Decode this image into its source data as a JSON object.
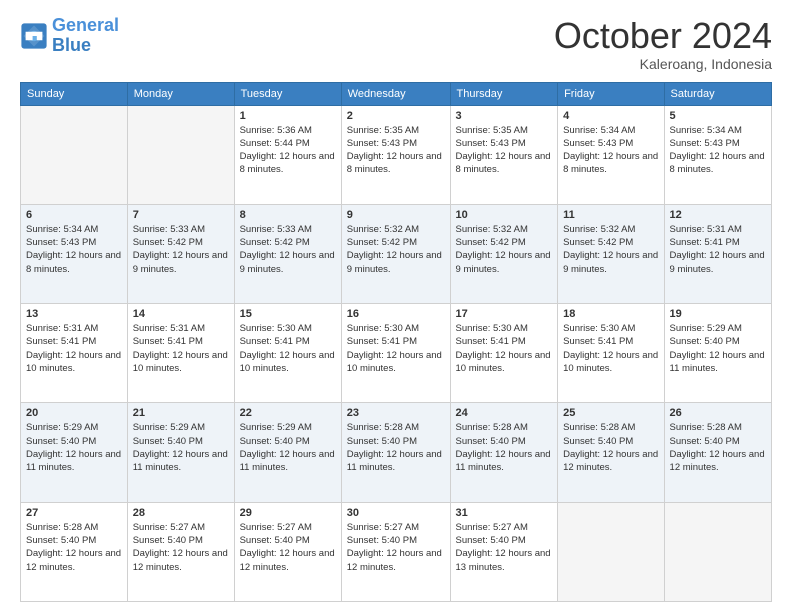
{
  "header": {
    "logo_general": "General",
    "logo_blue": "Blue",
    "month_title": "October 2024",
    "location": "Kaleroang, Indonesia"
  },
  "days_of_week": [
    "Sunday",
    "Monday",
    "Tuesday",
    "Wednesday",
    "Thursday",
    "Friday",
    "Saturday"
  ],
  "weeks": [
    [
      {
        "day": "",
        "info": ""
      },
      {
        "day": "",
        "info": ""
      },
      {
        "day": "1",
        "info": "Sunrise: 5:36 AM\nSunset: 5:44 PM\nDaylight: 12 hours and 8 minutes."
      },
      {
        "day": "2",
        "info": "Sunrise: 5:35 AM\nSunset: 5:43 PM\nDaylight: 12 hours and 8 minutes."
      },
      {
        "day": "3",
        "info": "Sunrise: 5:35 AM\nSunset: 5:43 PM\nDaylight: 12 hours and 8 minutes."
      },
      {
        "day": "4",
        "info": "Sunrise: 5:34 AM\nSunset: 5:43 PM\nDaylight: 12 hours and 8 minutes."
      },
      {
        "day": "5",
        "info": "Sunrise: 5:34 AM\nSunset: 5:43 PM\nDaylight: 12 hours and 8 minutes."
      }
    ],
    [
      {
        "day": "6",
        "info": "Sunrise: 5:34 AM\nSunset: 5:43 PM\nDaylight: 12 hours and 8 minutes."
      },
      {
        "day": "7",
        "info": "Sunrise: 5:33 AM\nSunset: 5:42 PM\nDaylight: 12 hours and 9 minutes."
      },
      {
        "day": "8",
        "info": "Sunrise: 5:33 AM\nSunset: 5:42 PM\nDaylight: 12 hours and 9 minutes."
      },
      {
        "day": "9",
        "info": "Sunrise: 5:32 AM\nSunset: 5:42 PM\nDaylight: 12 hours and 9 minutes."
      },
      {
        "day": "10",
        "info": "Sunrise: 5:32 AM\nSunset: 5:42 PM\nDaylight: 12 hours and 9 minutes."
      },
      {
        "day": "11",
        "info": "Sunrise: 5:32 AM\nSunset: 5:42 PM\nDaylight: 12 hours and 9 minutes."
      },
      {
        "day": "12",
        "info": "Sunrise: 5:31 AM\nSunset: 5:41 PM\nDaylight: 12 hours and 9 minutes."
      }
    ],
    [
      {
        "day": "13",
        "info": "Sunrise: 5:31 AM\nSunset: 5:41 PM\nDaylight: 12 hours and 10 minutes."
      },
      {
        "day": "14",
        "info": "Sunrise: 5:31 AM\nSunset: 5:41 PM\nDaylight: 12 hours and 10 minutes."
      },
      {
        "day": "15",
        "info": "Sunrise: 5:30 AM\nSunset: 5:41 PM\nDaylight: 12 hours and 10 minutes."
      },
      {
        "day": "16",
        "info": "Sunrise: 5:30 AM\nSunset: 5:41 PM\nDaylight: 12 hours and 10 minutes."
      },
      {
        "day": "17",
        "info": "Sunrise: 5:30 AM\nSunset: 5:41 PM\nDaylight: 12 hours and 10 minutes."
      },
      {
        "day": "18",
        "info": "Sunrise: 5:30 AM\nSunset: 5:41 PM\nDaylight: 12 hours and 10 minutes."
      },
      {
        "day": "19",
        "info": "Sunrise: 5:29 AM\nSunset: 5:40 PM\nDaylight: 12 hours and 11 minutes."
      }
    ],
    [
      {
        "day": "20",
        "info": "Sunrise: 5:29 AM\nSunset: 5:40 PM\nDaylight: 12 hours and 11 minutes."
      },
      {
        "day": "21",
        "info": "Sunrise: 5:29 AM\nSunset: 5:40 PM\nDaylight: 12 hours and 11 minutes."
      },
      {
        "day": "22",
        "info": "Sunrise: 5:29 AM\nSunset: 5:40 PM\nDaylight: 12 hours and 11 minutes."
      },
      {
        "day": "23",
        "info": "Sunrise: 5:28 AM\nSunset: 5:40 PM\nDaylight: 12 hours and 11 minutes."
      },
      {
        "day": "24",
        "info": "Sunrise: 5:28 AM\nSunset: 5:40 PM\nDaylight: 12 hours and 11 minutes."
      },
      {
        "day": "25",
        "info": "Sunrise: 5:28 AM\nSunset: 5:40 PM\nDaylight: 12 hours and 12 minutes."
      },
      {
        "day": "26",
        "info": "Sunrise: 5:28 AM\nSunset: 5:40 PM\nDaylight: 12 hours and 12 minutes."
      }
    ],
    [
      {
        "day": "27",
        "info": "Sunrise: 5:28 AM\nSunset: 5:40 PM\nDaylight: 12 hours and 12 minutes."
      },
      {
        "day": "28",
        "info": "Sunrise: 5:27 AM\nSunset: 5:40 PM\nDaylight: 12 hours and 12 minutes."
      },
      {
        "day": "29",
        "info": "Sunrise: 5:27 AM\nSunset: 5:40 PM\nDaylight: 12 hours and 12 minutes."
      },
      {
        "day": "30",
        "info": "Sunrise: 5:27 AM\nSunset: 5:40 PM\nDaylight: 12 hours and 12 minutes."
      },
      {
        "day": "31",
        "info": "Sunrise: 5:27 AM\nSunset: 5:40 PM\nDaylight: 12 hours and 13 minutes."
      },
      {
        "day": "",
        "info": ""
      },
      {
        "day": "",
        "info": ""
      }
    ]
  ]
}
